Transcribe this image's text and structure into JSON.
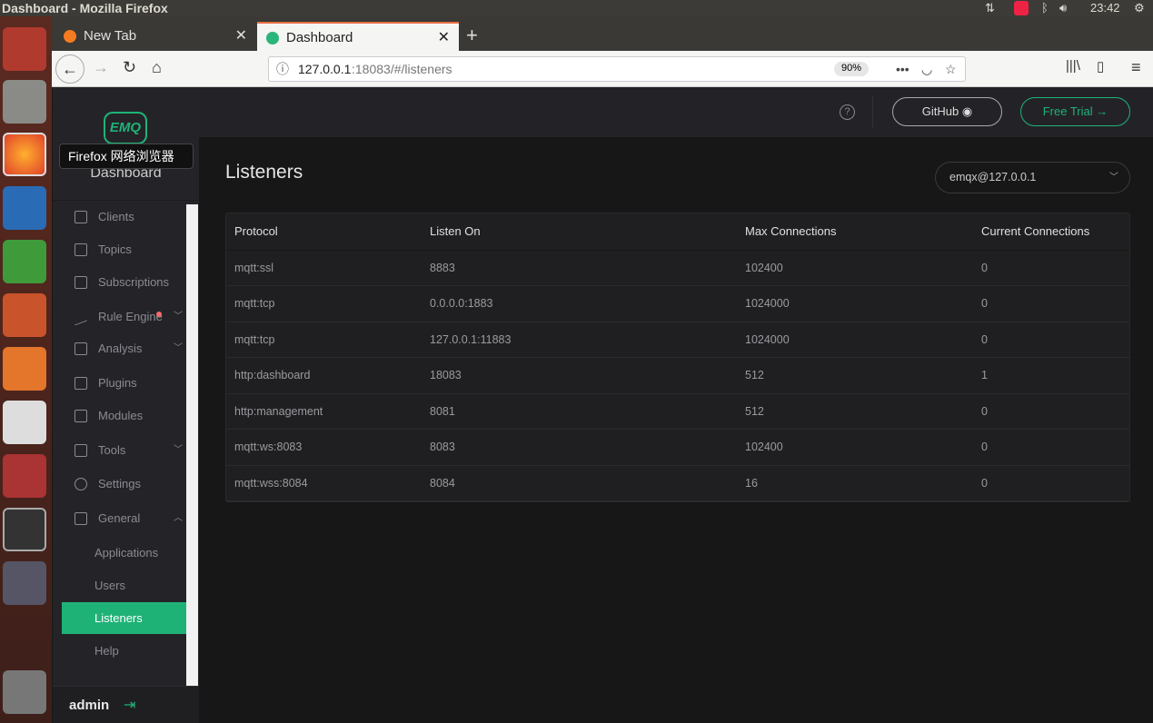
{
  "os": {
    "window_title": "Dashboard - Mozilla Firefox",
    "clock": "23:42",
    "tooltip": "Firefox 网络浏览器"
  },
  "browser": {
    "tabs": [
      {
        "label": "New Tab",
        "active": false
      },
      {
        "label": "Dashboard",
        "active": true
      }
    ],
    "url_host": "127.0.0.1",
    "url_rest": ":18083/#/listeners",
    "zoom": "90%"
  },
  "app": {
    "logo": "EMQ",
    "subtitle": "Dashboard",
    "accent": "#1fb277",
    "header": {
      "github": "GitHub",
      "free_trial": "Free Trial →"
    },
    "sidebar": {
      "items": [
        {
          "label": "Clients",
          "icon": "clients-icon"
        },
        {
          "label": "Topics",
          "icon": "topics-icon"
        },
        {
          "label": "Subscriptions",
          "icon": "subscriptions-icon"
        },
        {
          "label": "Rule Engine",
          "icon": "rule-engine-icon",
          "expandable": true,
          "badge": true
        },
        {
          "label": "Analysis",
          "icon": "analysis-icon",
          "expandable": true
        },
        {
          "label": "Plugins",
          "icon": "plugins-icon"
        },
        {
          "label": "Modules",
          "icon": "modules-icon"
        },
        {
          "label": "Tools",
          "icon": "tools-icon",
          "expandable": true
        },
        {
          "label": "Settings",
          "icon": "settings-icon"
        },
        {
          "label": "General",
          "icon": "general-icon",
          "expanded": true
        }
      ],
      "subitems": [
        {
          "label": "Applications"
        },
        {
          "label": "Users"
        },
        {
          "label": "Listeners",
          "active": true
        },
        {
          "label": "Help"
        }
      ],
      "user": "admin"
    },
    "page": {
      "title": "Listeners",
      "node": "emqx@127.0.0.1",
      "columns": [
        "Protocol",
        "Listen On",
        "Max Connections",
        "Current Connections"
      ],
      "rows": [
        [
          "mqtt:ssl",
          "8883",
          "102400",
          "0"
        ],
        [
          "mqtt:tcp",
          "0.0.0.0:1883",
          "1024000",
          "0"
        ],
        [
          "mqtt:tcp",
          "127.0.0.1:11883",
          "1024000",
          "0"
        ],
        [
          "http:dashboard",
          "18083",
          "512",
          "1"
        ],
        [
          "http:management",
          "8081",
          "512",
          "0"
        ],
        [
          "mqtt:ws:8083",
          "8083",
          "102400",
          "0"
        ],
        [
          "mqtt:wss:8084",
          "8084",
          "16",
          "0"
        ]
      ]
    }
  }
}
